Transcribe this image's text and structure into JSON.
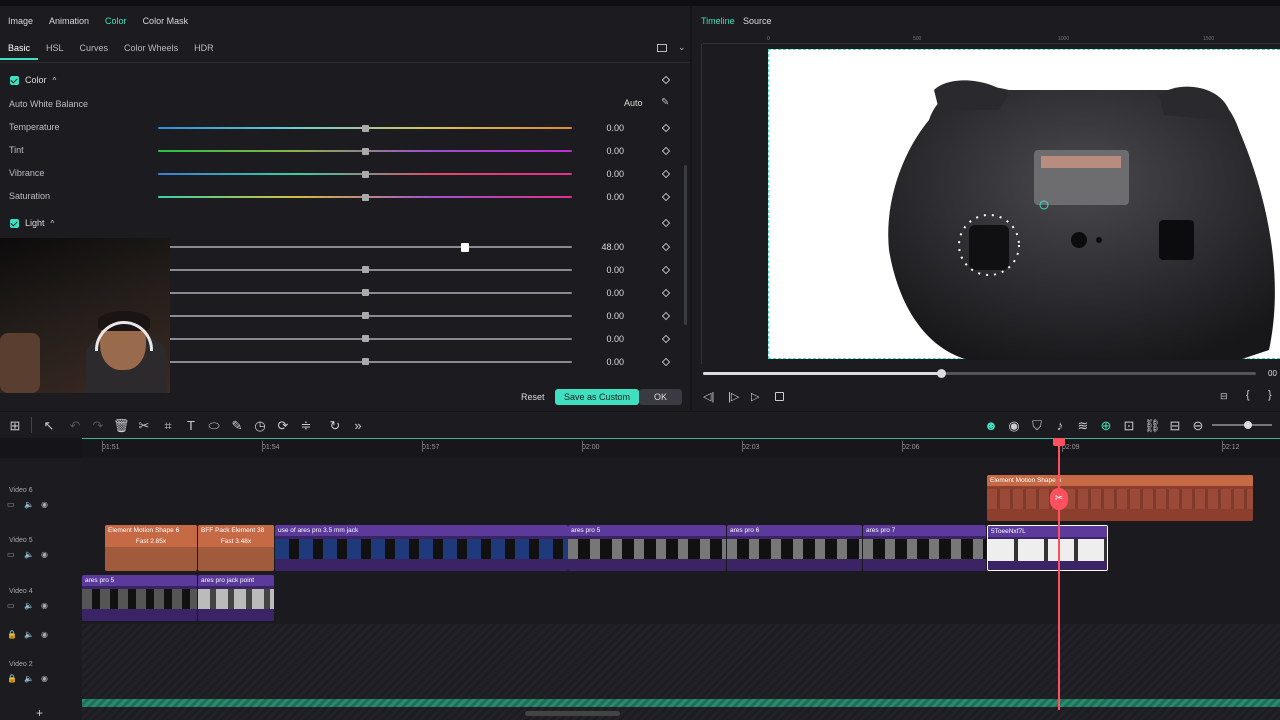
{
  "tabs_primary": [
    "Image",
    "Animation",
    "Color",
    "Color Mask"
  ],
  "tabs_primary_active": "Color",
  "tabs_secondary": [
    "Basic",
    "HSL",
    "Curves",
    "Color Wheels",
    "HDR"
  ],
  "tabs_secondary_active": "Basic",
  "color_section": {
    "title": "Color",
    "awb_label": "Auto White Balance",
    "auto_label": "Auto",
    "rows": [
      {
        "label": "Temperature",
        "value": "0.00",
        "fraction": 0.5
      },
      {
        "label": "Tint",
        "value": "0.00",
        "fraction": 0.5
      },
      {
        "label": "Vibrance",
        "value": "0.00",
        "fraction": 0.5
      },
      {
        "label": "Saturation",
        "value": "0.00",
        "fraction": 0.5
      }
    ]
  },
  "light_section": {
    "title": "Light",
    "rows": [
      {
        "value": "48.00",
        "fraction": 0.74
      },
      {
        "value": "0.00",
        "fraction": 0.5
      },
      {
        "value": "0.00",
        "fraction": 0.5
      },
      {
        "value": "0.00",
        "fraction": 0.5
      },
      {
        "value": "0.00",
        "fraction": 0.5
      },
      {
        "value": "0.00",
        "fraction": 0.5
      }
    ]
  },
  "buttons": {
    "reset": "Reset",
    "save_custom": "Save as Custom",
    "ok": "OK"
  },
  "preview": {
    "tab_timeline": "Timeline",
    "tab_source": "Source",
    "ruler_marks": [
      "0",
      "500",
      "1000",
      "1500"
    ],
    "scrub_progress": 0.43,
    "time_partial": "00"
  },
  "timeline": {
    "ruler_times": [
      "01:51",
      "01:54",
      "01:57",
      "02:00",
      "02:03",
      "02:06",
      "02:09",
      "02:12"
    ],
    "tracks": [
      {
        "name": "Video 6"
      },
      {
        "name": "Video 5"
      },
      {
        "name": "Video 4"
      },
      {
        "name": ""
      },
      {
        "name": "Video 2"
      }
    ],
    "clips_v6": [
      {
        "title": "Element Motion Shape 6"
      }
    ],
    "clips_v5": [
      {
        "title": "Element Motion Shape 6",
        "speed": "Fast 2.85x"
      },
      {
        "title": "BFF Pack Element 38",
        "speed": "Fast 3.48x"
      },
      {
        "title": "use of ares pro 3.5 mm jack"
      },
      {
        "title": "ares pro 5"
      },
      {
        "title": "ares pro 6"
      },
      {
        "title": "ares pro 7"
      },
      {
        "title": "5ToeeNxf7L"
      }
    ],
    "clips_v4": [
      {
        "title": "ares pro 5"
      },
      {
        "title": "ares pro jack point"
      }
    ]
  },
  "colors": {
    "accent": "#3fe0c0",
    "clip_purple": "#5b3a9c",
    "clip_orange": "#c66a45",
    "playhead": "#ff5060"
  }
}
